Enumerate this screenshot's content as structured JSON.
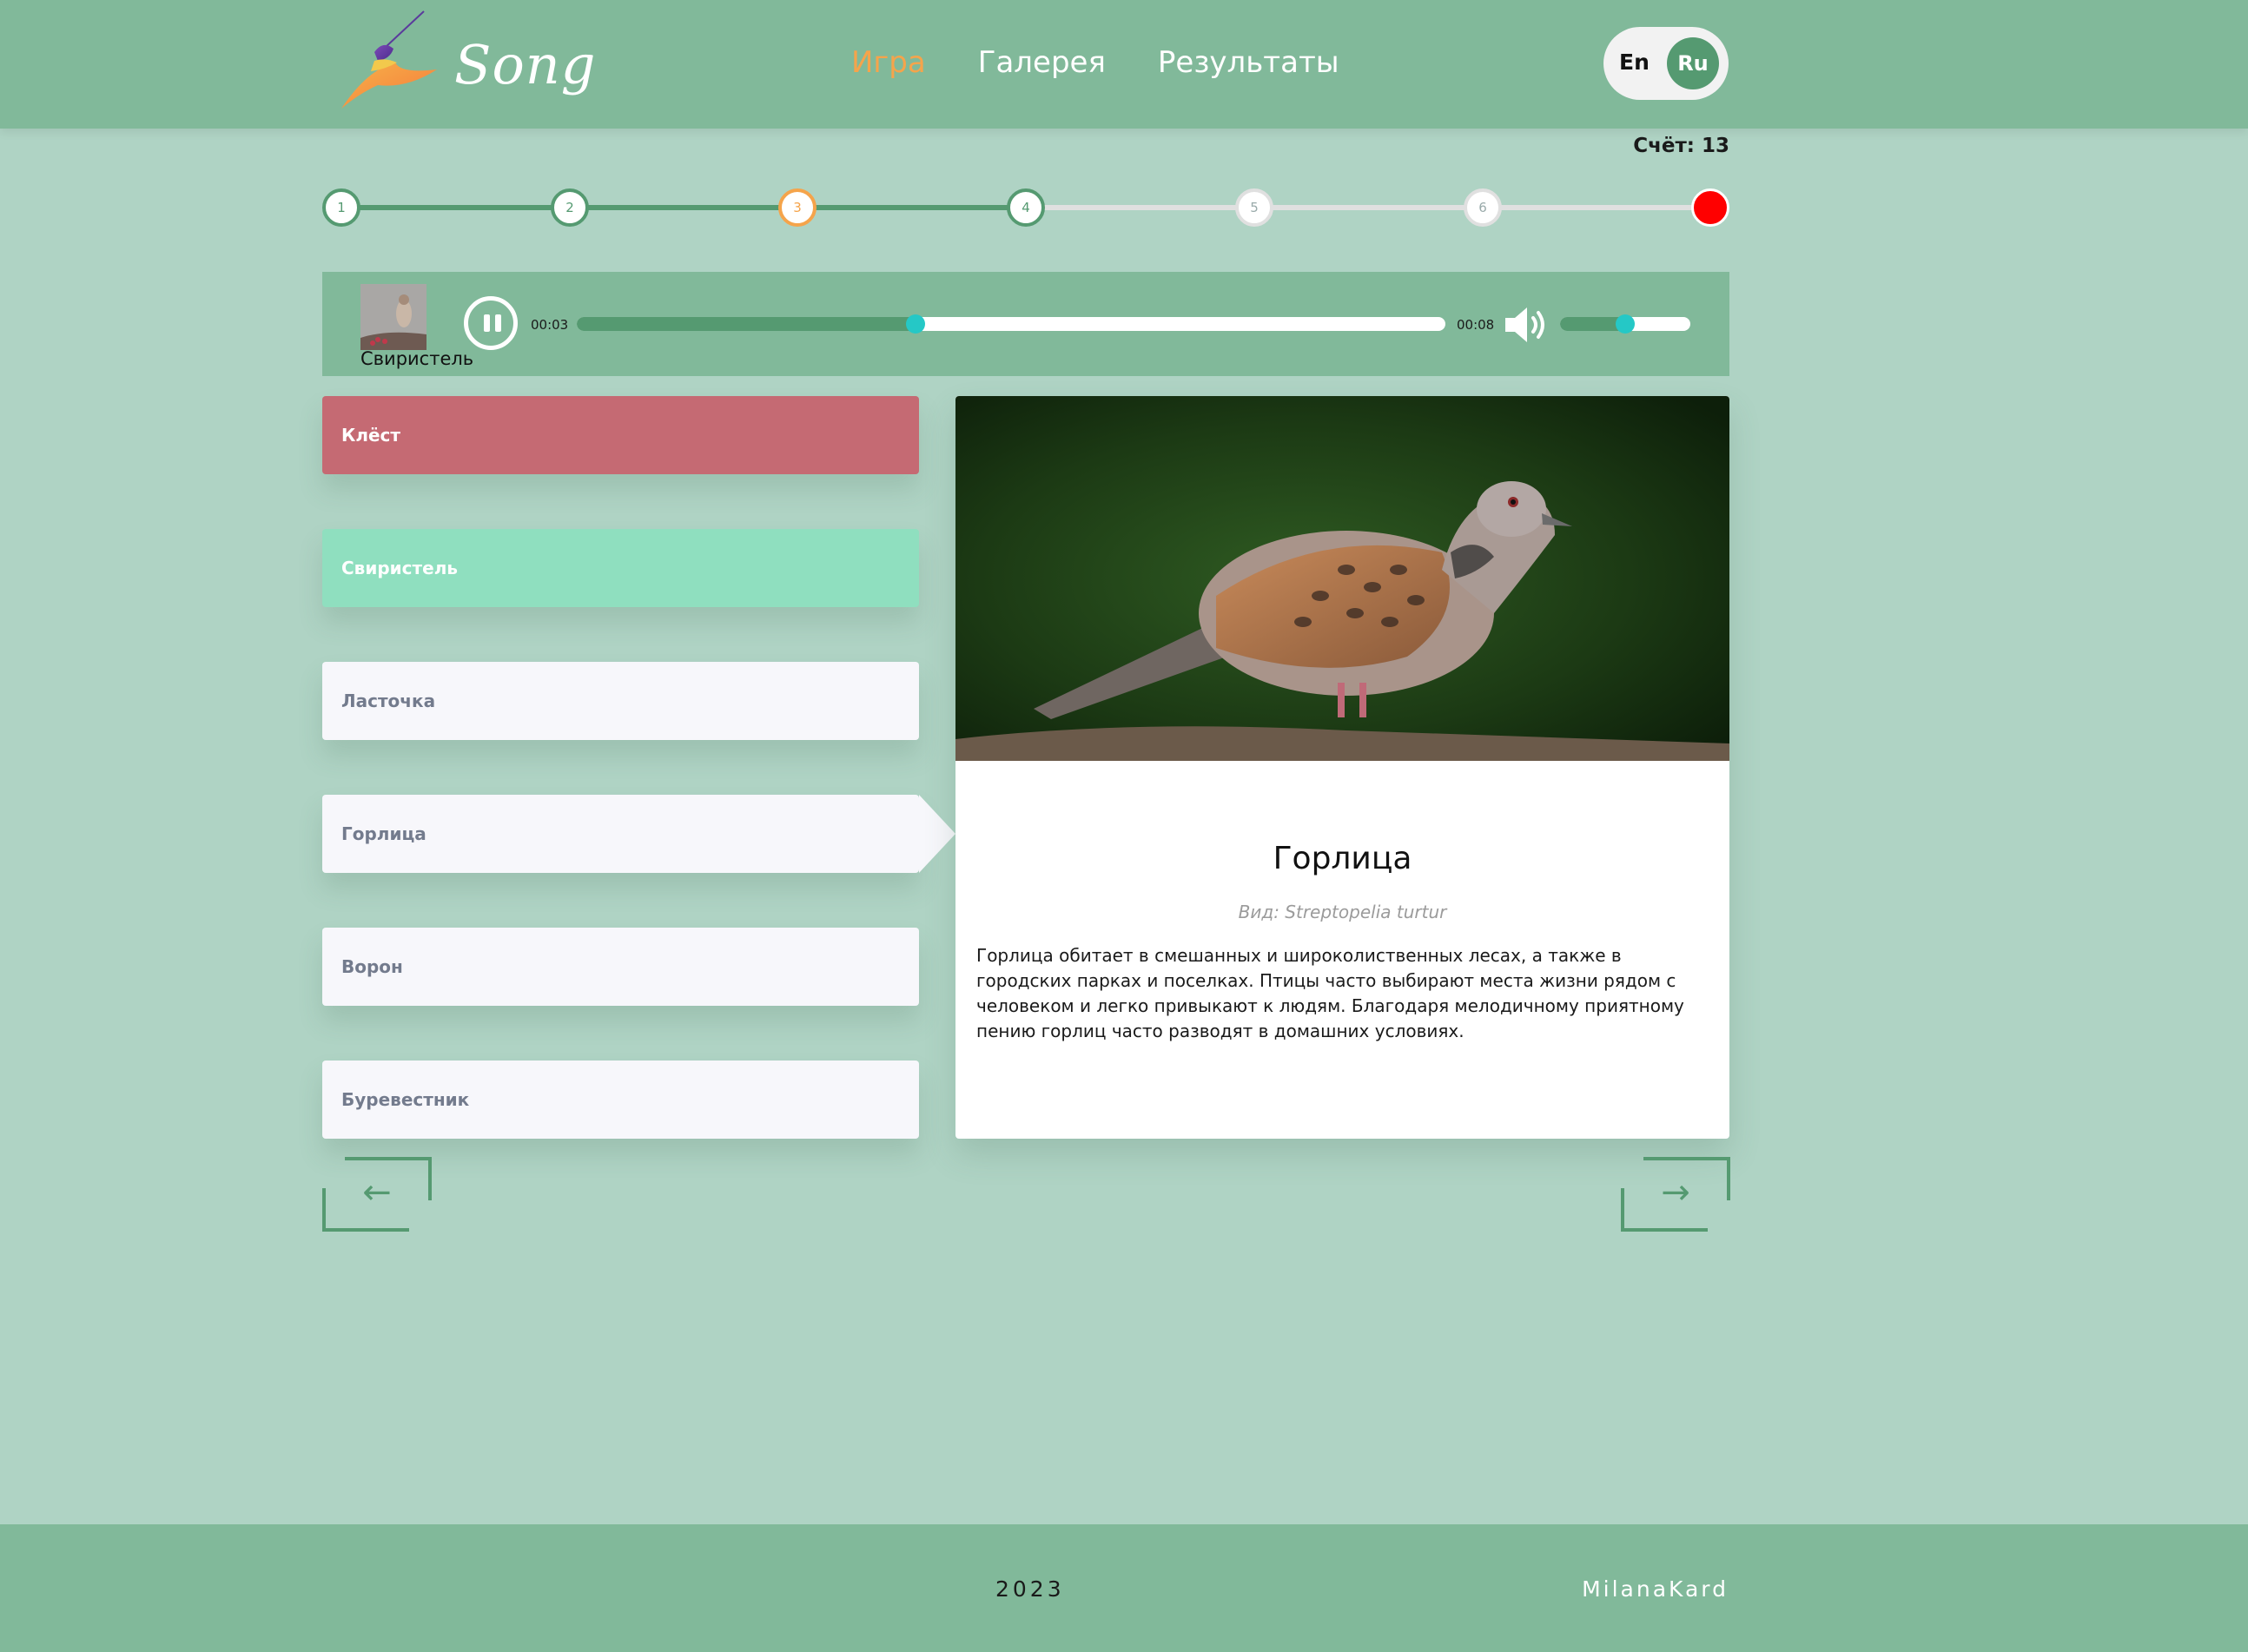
{
  "header": {
    "logo_text": "Song",
    "nav": [
      {
        "label": "Игра",
        "active": true
      },
      {
        "label": "Галерея",
        "active": false
      },
      {
        "label": "Результаты",
        "active": false
      }
    ],
    "lang": {
      "en": "En",
      "ru": "Ru",
      "selected": "Ru"
    }
  },
  "score": "Счёт: 13",
  "stepper": {
    "steps": [
      "1",
      "2",
      "3",
      "4",
      "5",
      "6"
    ],
    "current_step": "3",
    "colors": {
      "done": "#559a71",
      "current": "#f5a44b",
      "future": "#e0e0e0",
      "end": "#ff0000"
    }
  },
  "player": {
    "thumb_caption": "Свиристель",
    "current_time": "00:03",
    "duration": "00:08",
    "progress_fraction": 0.39,
    "volume_fraction": 0.5,
    "state": "playing"
  },
  "answers": [
    {
      "label": "Клёст",
      "state": "wrong"
    },
    {
      "label": "Свиристель",
      "state": "right"
    },
    {
      "label": "Ласточка",
      "state": "default"
    },
    {
      "label": "Горлица",
      "state": "selected"
    },
    {
      "label": "Ворон",
      "state": "default"
    },
    {
      "label": "Буревестник",
      "state": "default"
    }
  ],
  "details": {
    "title": "Горлица",
    "species": "Вид: Streptopelia turtur",
    "description": "Горлица обитает в смешанных и широколиственных лесах, а также в городских парках и поселках. Птицы часто выбирают места жизни рядом с человеком и легко привыкают к людям. Благодаря мелодичному приятному пению горлиц часто разводят в домашних условиях."
  },
  "nav_arrows": {
    "prev": "←",
    "next": "→"
  },
  "footer": {
    "year": "2023",
    "author": "MilanaKard"
  },
  "colors": {
    "background": "#afd3c4",
    "header": "#81b99a",
    "accent": "#f5a44b",
    "primary": "#559a71",
    "wrong": "#c56a73",
    "right": "#8fdfbf",
    "thumb": "#25c8c6"
  }
}
